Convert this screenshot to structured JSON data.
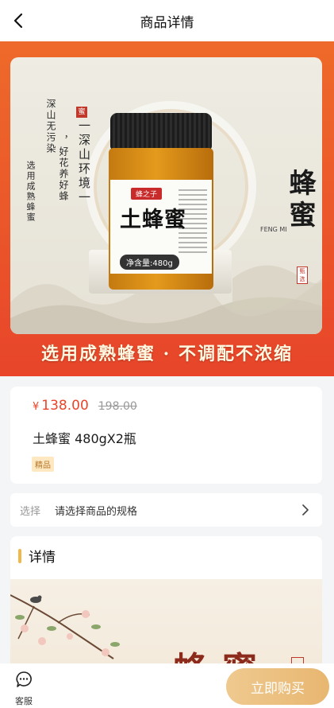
{
  "nav": {
    "title": "商品详情",
    "back_icon": "chevron-left-icon"
  },
  "hero": {
    "jar_brand": "蜂之子",
    "jar_name": "土蜂蜜",
    "jar_net": "净含量:480g",
    "seal_small": "蜜",
    "left_line1": "深山无污染",
    "left_line2": "，好花养好蜂",
    "left_line3": "选用成熟蜂蜜",
    "left_line4": "一深山环境一",
    "right_title": "蜂蜜",
    "right_seal": "甄选",
    "feng_mi": "FENG MI",
    "banner": "选用成熟蜂蜜 · 不调配不浓缩",
    "colors": {
      "banner_bg": "#e8452a",
      "card_bg": "#eeece3"
    }
  },
  "product": {
    "currency": "¥",
    "price": "138.00",
    "original_price": "198.00",
    "title": "土蜂蜜 480gX2瓶",
    "tag": "精品",
    "colors": {
      "price": "#e8452a",
      "tag_bg": "#fde8c2"
    }
  },
  "spec": {
    "key": "选择",
    "value": "请选择商品的规格",
    "arrow_icon": "chevron-right-icon"
  },
  "details": {
    "heading": "详情",
    "art_title": "蜂蜜"
  },
  "bottom": {
    "service_label": "客服",
    "service_icon": "chat-bubble-icon",
    "buy_label": "立即购买",
    "buy_color": "#e8b771"
  }
}
